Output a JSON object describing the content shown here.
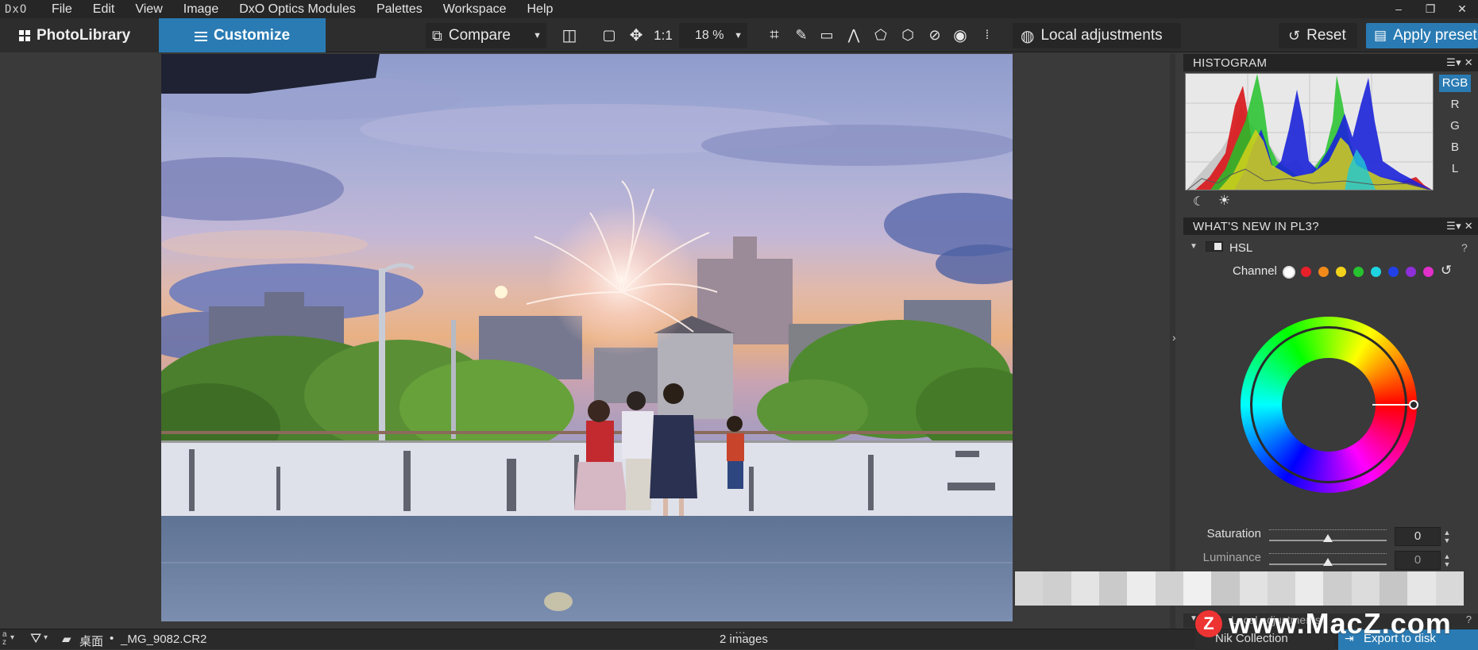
{
  "menubar": {
    "logo": "DxO",
    "items": [
      "File",
      "Edit",
      "View",
      "Image",
      "DxO Optics Modules",
      "Palettes",
      "Workspace",
      "Help"
    ]
  },
  "toolbar": {
    "tab_photolibrary": "PhotoLibrary",
    "tab_customize": "Customize",
    "compare_label": "Compare",
    "one_to_one": "1:1",
    "zoom_value": "18 %",
    "local_adjustments_label": "Local adjustments",
    "reset_label": "Reset",
    "apply_preset_label": "Apply preset"
  },
  "histogram": {
    "title": "HISTOGRAM",
    "channels": [
      "RGB",
      "R",
      "G",
      "B",
      "L"
    ],
    "active_channel": "RGB"
  },
  "whats_new": {
    "title": "WHAT'S NEW IN PL3?",
    "hsl_label": "HSL",
    "help": "?",
    "channel_label": "Channel",
    "channel_colors": [
      "#ffffff",
      "#e8202a",
      "#f08a1a",
      "#f2d21a",
      "#27c22f",
      "#1fd2e0",
      "#2140e8",
      "#8e2fd8",
      "#e12fc9"
    ],
    "saturation_label": "Saturation",
    "saturation_value": "0",
    "luminance_label": "Luminance",
    "luminance_value": "0",
    "local_adjustments_collapsed": "Local adjustments"
  },
  "statusbar": {
    "path_folder": "桌面",
    "separator": "•",
    "filename": "_MG_9082.CR2",
    "image_count": "2 images",
    "nik_collection": "Nik Collection",
    "export_to_disk": "Export to disk"
  },
  "watermark": {
    "text": "www.MacZ.com",
    "badge": "Z"
  },
  "colors": {
    "accent": "#2a7bb3",
    "panel_bg": "#3a3a3a",
    "header_bg": "#242424"
  }
}
